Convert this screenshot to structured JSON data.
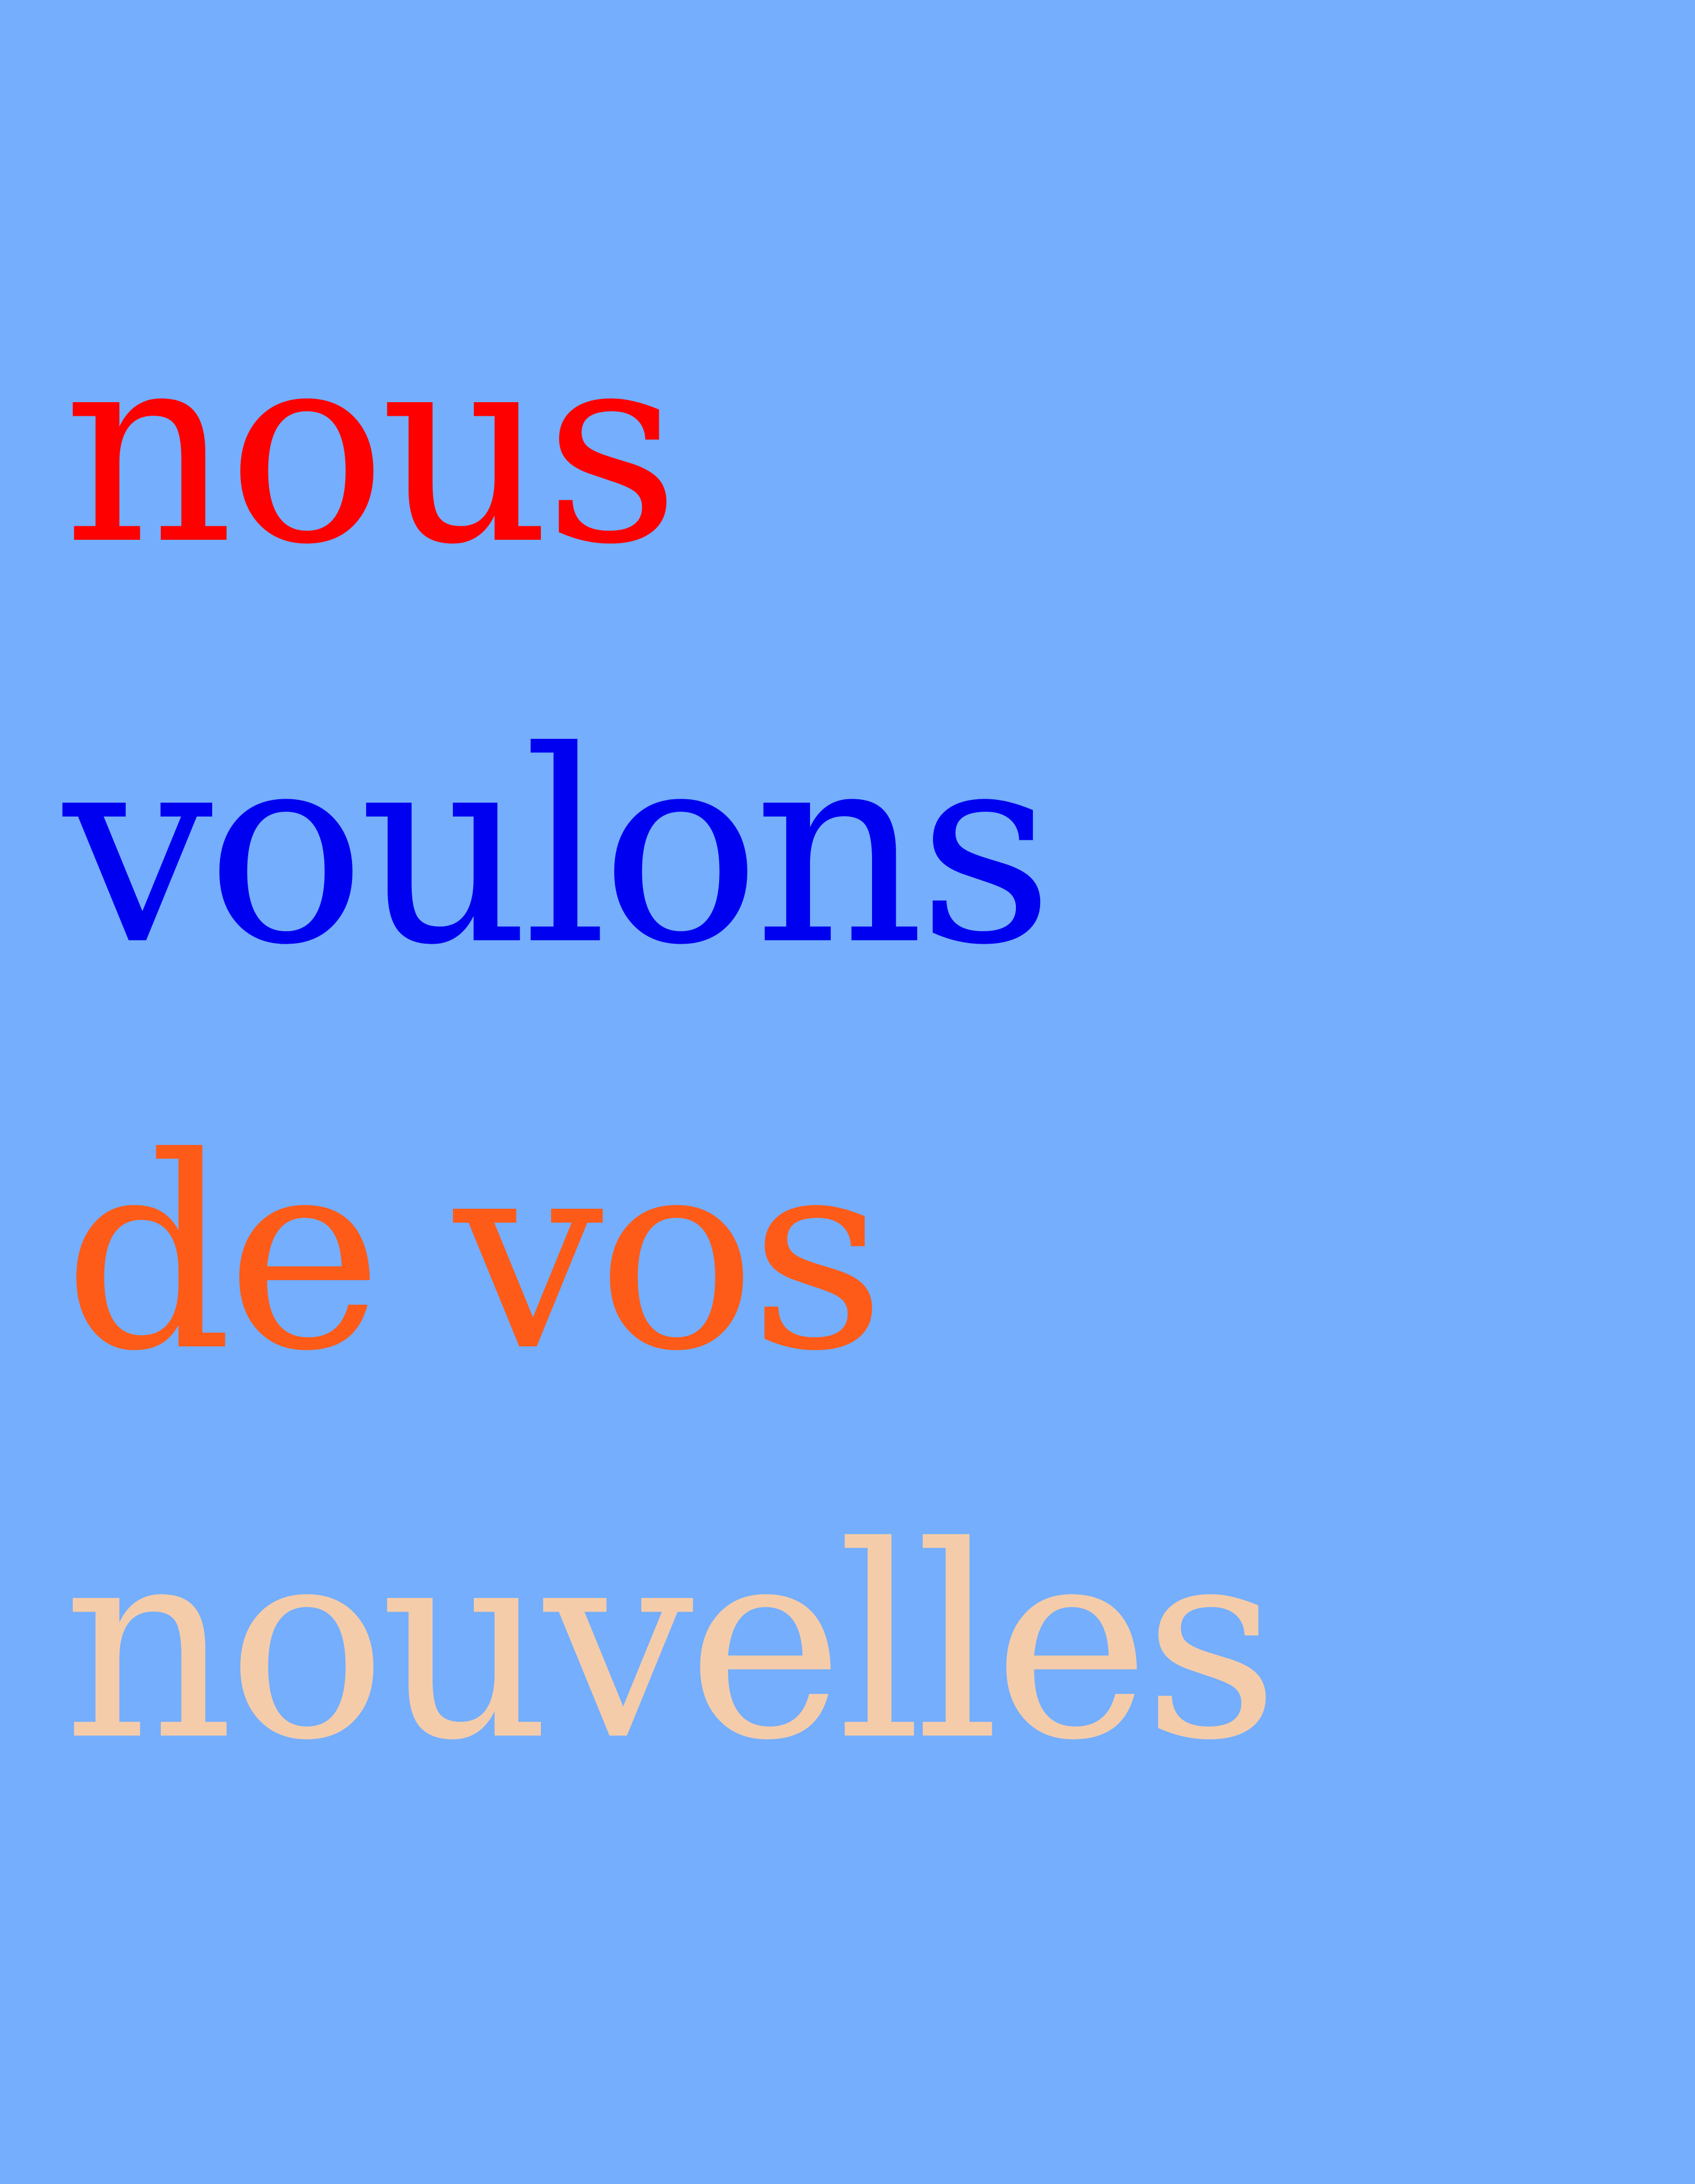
{
  "poster": {
    "lines": [
      {
        "text": "nous",
        "color": "#fe0000"
      },
      {
        "text": "voulons",
        "color": "#0000f0"
      },
      {
        "text": "de vos",
        "color": "#fe5b18"
      },
      {
        "text": "nouvelles",
        "color": "#f5ccaa"
      }
    ],
    "background_color": "#74aefc"
  }
}
